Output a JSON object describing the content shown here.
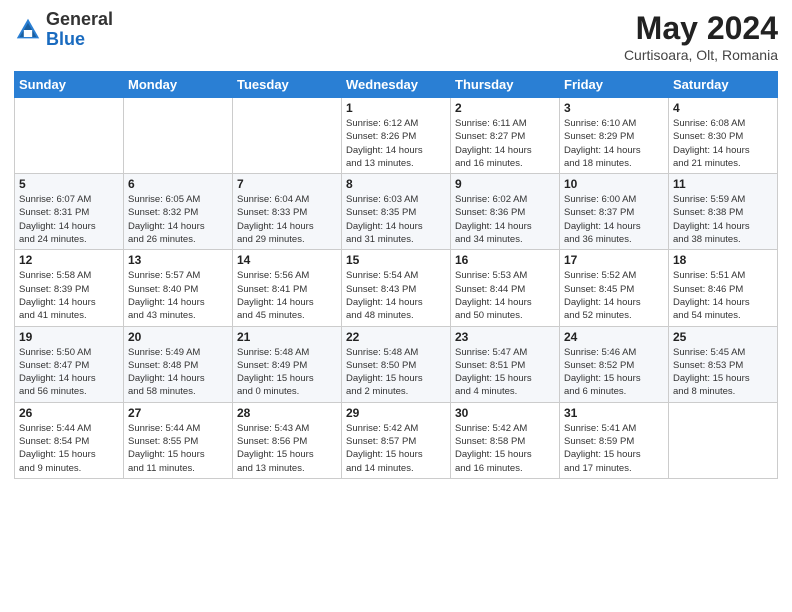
{
  "header": {
    "logo": {
      "general": "General",
      "blue": "Blue"
    },
    "title": "May 2024",
    "location": "Curtisoara, Olt, Romania"
  },
  "weekdays": [
    "Sunday",
    "Monday",
    "Tuesday",
    "Wednesday",
    "Thursday",
    "Friday",
    "Saturday"
  ],
  "weeks": [
    [
      {
        "day": "",
        "info": ""
      },
      {
        "day": "",
        "info": ""
      },
      {
        "day": "",
        "info": ""
      },
      {
        "day": "1",
        "info": "Sunrise: 6:12 AM\nSunset: 8:26 PM\nDaylight: 14 hours\nand 13 minutes."
      },
      {
        "day": "2",
        "info": "Sunrise: 6:11 AM\nSunset: 8:27 PM\nDaylight: 14 hours\nand 16 minutes."
      },
      {
        "day": "3",
        "info": "Sunrise: 6:10 AM\nSunset: 8:29 PM\nDaylight: 14 hours\nand 18 minutes."
      },
      {
        "day": "4",
        "info": "Sunrise: 6:08 AM\nSunset: 8:30 PM\nDaylight: 14 hours\nand 21 minutes."
      }
    ],
    [
      {
        "day": "5",
        "info": "Sunrise: 6:07 AM\nSunset: 8:31 PM\nDaylight: 14 hours\nand 24 minutes."
      },
      {
        "day": "6",
        "info": "Sunrise: 6:05 AM\nSunset: 8:32 PM\nDaylight: 14 hours\nand 26 minutes."
      },
      {
        "day": "7",
        "info": "Sunrise: 6:04 AM\nSunset: 8:33 PM\nDaylight: 14 hours\nand 29 minutes."
      },
      {
        "day": "8",
        "info": "Sunrise: 6:03 AM\nSunset: 8:35 PM\nDaylight: 14 hours\nand 31 minutes."
      },
      {
        "day": "9",
        "info": "Sunrise: 6:02 AM\nSunset: 8:36 PM\nDaylight: 14 hours\nand 34 minutes."
      },
      {
        "day": "10",
        "info": "Sunrise: 6:00 AM\nSunset: 8:37 PM\nDaylight: 14 hours\nand 36 minutes."
      },
      {
        "day": "11",
        "info": "Sunrise: 5:59 AM\nSunset: 8:38 PM\nDaylight: 14 hours\nand 38 minutes."
      }
    ],
    [
      {
        "day": "12",
        "info": "Sunrise: 5:58 AM\nSunset: 8:39 PM\nDaylight: 14 hours\nand 41 minutes."
      },
      {
        "day": "13",
        "info": "Sunrise: 5:57 AM\nSunset: 8:40 PM\nDaylight: 14 hours\nand 43 minutes."
      },
      {
        "day": "14",
        "info": "Sunrise: 5:56 AM\nSunset: 8:41 PM\nDaylight: 14 hours\nand 45 minutes."
      },
      {
        "day": "15",
        "info": "Sunrise: 5:54 AM\nSunset: 8:43 PM\nDaylight: 14 hours\nand 48 minutes."
      },
      {
        "day": "16",
        "info": "Sunrise: 5:53 AM\nSunset: 8:44 PM\nDaylight: 14 hours\nand 50 minutes."
      },
      {
        "day": "17",
        "info": "Sunrise: 5:52 AM\nSunset: 8:45 PM\nDaylight: 14 hours\nand 52 minutes."
      },
      {
        "day": "18",
        "info": "Sunrise: 5:51 AM\nSunset: 8:46 PM\nDaylight: 14 hours\nand 54 minutes."
      }
    ],
    [
      {
        "day": "19",
        "info": "Sunrise: 5:50 AM\nSunset: 8:47 PM\nDaylight: 14 hours\nand 56 minutes."
      },
      {
        "day": "20",
        "info": "Sunrise: 5:49 AM\nSunset: 8:48 PM\nDaylight: 14 hours\nand 58 minutes."
      },
      {
        "day": "21",
        "info": "Sunrise: 5:48 AM\nSunset: 8:49 PM\nDaylight: 15 hours\nand 0 minutes."
      },
      {
        "day": "22",
        "info": "Sunrise: 5:48 AM\nSunset: 8:50 PM\nDaylight: 15 hours\nand 2 minutes."
      },
      {
        "day": "23",
        "info": "Sunrise: 5:47 AM\nSunset: 8:51 PM\nDaylight: 15 hours\nand 4 minutes."
      },
      {
        "day": "24",
        "info": "Sunrise: 5:46 AM\nSunset: 8:52 PM\nDaylight: 15 hours\nand 6 minutes."
      },
      {
        "day": "25",
        "info": "Sunrise: 5:45 AM\nSunset: 8:53 PM\nDaylight: 15 hours\nand 8 minutes."
      }
    ],
    [
      {
        "day": "26",
        "info": "Sunrise: 5:44 AM\nSunset: 8:54 PM\nDaylight: 15 hours\nand 9 minutes."
      },
      {
        "day": "27",
        "info": "Sunrise: 5:44 AM\nSunset: 8:55 PM\nDaylight: 15 hours\nand 11 minutes."
      },
      {
        "day": "28",
        "info": "Sunrise: 5:43 AM\nSunset: 8:56 PM\nDaylight: 15 hours\nand 13 minutes."
      },
      {
        "day": "29",
        "info": "Sunrise: 5:42 AM\nSunset: 8:57 PM\nDaylight: 15 hours\nand 14 minutes."
      },
      {
        "day": "30",
        "info": "Sunrise: 5:42 AM\nSunset: 8:58 PM\nDaylight: 15 hours\nand 16 minutes."
      },
      {
        "day": "31",
        "info": "Sunrise: 5:41 AM\nSunset: 8:59 PM\nDaylight: 15 hours\nand 17 minutes."
      },
      {
        "day": "",
        "info": ""
      }
    ]
  ]
}
